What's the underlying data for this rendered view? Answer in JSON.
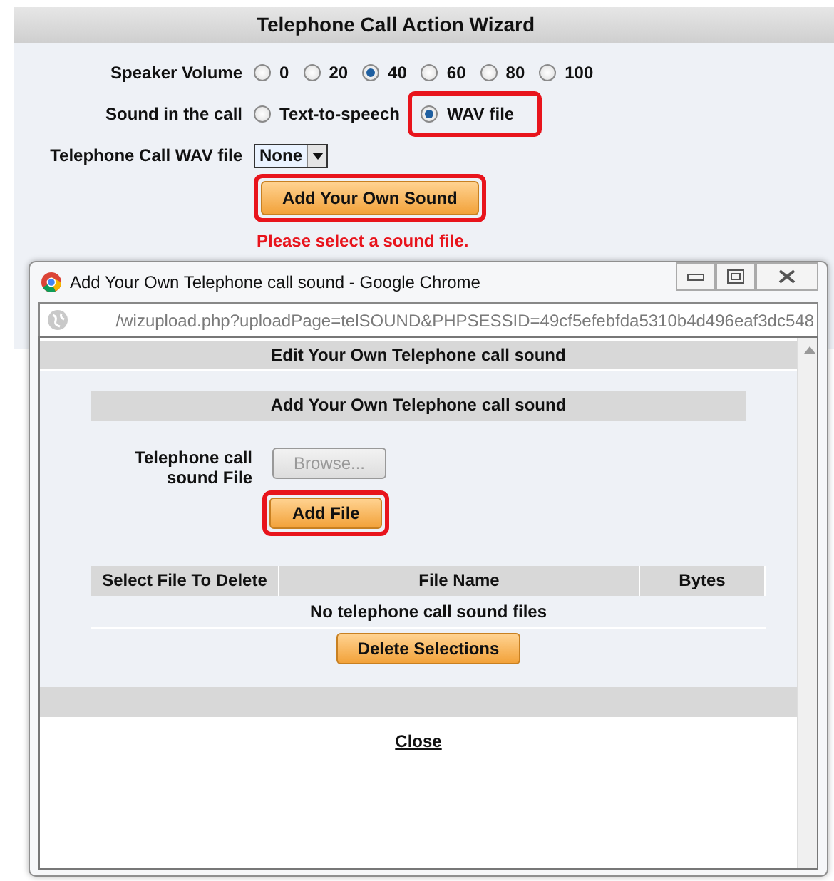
{
  "wizard": {
    "title": "Telephone Call Action Wizard",
    "speaker_volume": {
      "label": "Speaker Volume",
      "options": [
        {
          "label": "0",
          "selected": false
        },
        {
          "label": "20",
          "selected": false
        },
        {
          "label": "40",
          "selected": true
        },
        {
          "label": "60",
          "selected": false
        },
        {
          "label": "80",
          "selected": false
        },
        {
          "label": "100",
          "selected": false
        }
      ]
    },
    "sound_in_call": {
      "label": "Sound in the call",
      "options": [
        {
          "label": "Text-to-speech",
          "selected": false,
          "highlighted": false
        },
        {
          "label": "WAV file",
          "selected": true,
          "highlighted": true
        }
      ]
    },
    "wav_file": {
      "label": "Telephone Call WAV file",
      "value": "None"
    },
    "add_sound_button": {
      "label": "Add Your Own Sound",
      "highlighted": true
    },
    "error": "Please select a sound file."
  },
  "popup": {
    "title": "Add Your Own Telephone call sound - Google Chrome",
    "url": "/wizupload.php?uploadPage=telSOUND&PHPSESSID=49cf5efebfda5310b4d496eaf3dc548",
    "heading": "Edit Your Own Telephone call sound",
    "subheading": "Add Your Own Telephone call sound",
    "file_label": "Telephone call sound File",
    "browse_button": {
      "label": "Browse...",
      "disabled": true
    },
    "add_file_button": {
      "label": "Add File",
      "highlighted": true
    },
    "table": {
      "columns": [
        "Select File To Delete",
        "File Name",
        "Bytes"
      ],
      "empty_message": "No telephone call sound files"
    },
    "delete_button": "Delete Selections",
    "close_link": "Close"
  }
}
